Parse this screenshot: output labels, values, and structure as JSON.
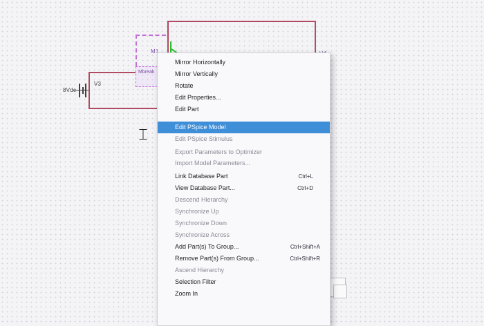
{
  "schematic": {
    "source_label": "8Vdc",
    "source_ref": "V3",
    "part_label": "Mbreak",
    "part_ref": "M1",
    "right_ref": "V4"
  },
  "menu": {
    "items": [
      {
        "label": "Mirror Horizontally",
        "shortcut": "",
        "state": "enabled"
      },
      {
        "label": "Mirror Vertically",
        "shortcut": "",
        "state": "enabled"
      },
      {
        "label": "Rotate",
        "shortcut": "",
        "state": "enabled"
      },
      {
        "label": "Edit Properties...",
        "shortcut": "",
        "state": "enabled"
      },
      {
        "label": "Edit Part",
        "shortcut": "",
        "state": "enabled"
      },
      {
        "label": "Edit PSpice Model",
        "shortcut": "",
        "state": "selected"
      },
      {
        "label": "Edit PSpice Stimulus",
        "shortcut": "",
        "state": "disabled"
      },
      {
        "label": "Export Parameters to Optimizer",
        "shortcut": "",
        "state": "disabled"
      },
      {
        "label": "Import Model Parameters...",
        "shortcut": "",
        "state": "disabled"
      },
      {
        "label": "Link Database Part",
        "shortcut": "Ctrl+L",
        "state": "enabled"
      },
      {
        "label": "View Database Part...",
        "shortcut": "Ctrl+D",
        "state": "enabled"
      },
      {
        "label": "Descend Hierarchy",
        "shortcut": "",
        "state": "disabled"
      },
      {
        "label": "Synchronize Up",
        "shortcut": "",
        "state": "disabled"
      },
      {
        "label": "Synchronize Down",
        "shortcut": "",
        "state": "disabled"
      },
      {
        "label": "Synchronize Across",
        "shortcut": "",
        "state": "disabled"
      },
      {
        "label": "Add Part(s) To Group...",
        "shortcut": "Ctrl+Shift+A",
        "state": "enabled"
      },
      {
        "label": "Remove Part(s) From Group...",
        "shortcut": "Ctrl+Shift+R",
        "state": "enabled"
      },
      {
        "label": "Ascend Hierarchy",
        "shortcut": "",
        "state": "disabled"
      },
      {
        "label": "Selection Filter",
        "shortcut": "",
        "state": "enabled"
      },
      {
        "label": "Zoom In",
        "shortcut": "",
        "state": "enabled"
      }
    ]
  },
  "colors": {
    "wire": "#b04a62",
    "selection": "#3f8ed8",
    "part_highlight": "#c26fd8",
    "pin": "#2cbf2c"
  }
}
